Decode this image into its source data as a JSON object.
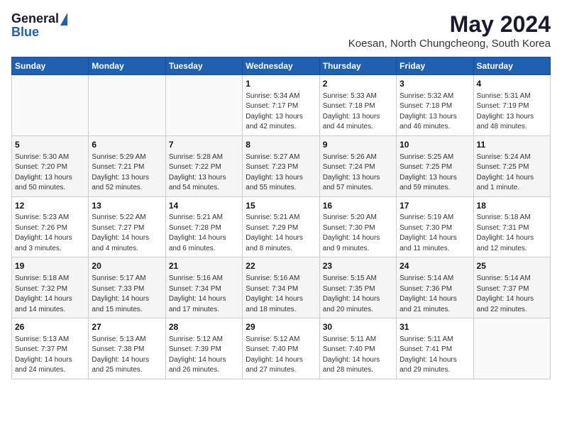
{
  "logo": {
    "general": "General",
    "blue": "Blue"
  },
  "title": {
    "month": "May 2024",
    "location": "Koesan, North Chungcheong, South Korea"
  },
  "weekdays": [
    "Sunday",
    "Monday",
    "Tuesday",
    "Wednesday",
    "Thursday",
    "Friday",
    "Saturday"
  ],
  "weeks": [
    [
      {
        "day": "",
        "sunrise": "",
        "sunset": "",
        "daylight": ""
      },
      {
        "day": "",
        "sunrise": "",
        "sunset": "",
        "daylight": ""
      },
      {
        "day": "",
        "sunrise": "",
        "sunset": "",
        "daylight": ""
      },
      {
        "day": "1",
        "sunrise": "Sunrise: 5:34 AM",
        "sunset": "Sunset: 7:17 PM",
        "daylight": "Daylight: 13 hours and 42 minutes."
      },
      {
        "day": "2",
        "sunrise": "Sunrise: 5:33 AM",
        "sunset": "Sunset: 7:18 PM",
        "daylight": "Daylight: 13 hours and 44 minutes."
      },
      {
        "day": "3",
        "sunrise": "Sunrise: 5:32 AM",
        "sunset": "Sunset: 7:18 PM",
        "daylight": "Daylight: 13 hours and 46 minutes."
      },
      {
        "day": "4",
        "sunrise": "Sunrise: 5:31 AM",
        "sunset": "Sunset: 7:19 PM",
        "daylight": "Daylight: 13 hours and 48 minutes."
      }
    ],
    [
      {
        "day": "5",
        "sunrise": "Sunrise: 5:30 AM",
        "sunset": "Sunset: 7:20 PM",
        "daylight": "Daylight: 13 hours and 50 minutes."
      },
      {
        "day": "6",
        "sunrise": "Sunrise: 5:29 AM",
        "sunset": "Sunset: 7:21 PM",
        "daylight": "Daylight: 13 hours and 52 minutes."
      },
      {
        "day": "7",
        "sunrise": "Sunrise: 5:28 AM",
        "sunset": "Sunset: 7:22 PM",
        "daylight": "Daylight: 13 hours and 54 minutes."
      },
      {
        "day": "8",
        "sunrise": "Sunrise: 5:27 AM",
        "sunset": "Sunset: 7:23 PM",
        "daylight": "Daylight: 13 hours and 55 minutes."
      },
      {
        "day": "9",
        "sunrise": "Sunrise: 5:26 AM",
        "sunset": "Sunset: 7:24 PM",
        "daylight": "Daylight: 13 hours and 57 minutes."
      },
      {
        "day": "10",
        "sunrise": "Sunrise: 5:25 AM",
        "sunset": "Sunset: 7:25 PM",
        "daylight": "Daylight: 13 hours and 59 minutes."
      },
      {
        "day": "11",
        "sunrise": "Sunrise: 5:24 AM",
        "sunset": "Sunset: 7:25 PM",
        "daylight": "Daylight: 14 hours and 1 minute."
      }
    ],
    [
      {
        "day": "12",
        "sunrise": "Sunrise: 5:23 AM",
        "sunset": "Sunset: 7:26 PM",
        "daylight": "Daylight: 14 hours and 3 minutes."
      },
      {
        "day": "13",
        "sunrise": "Sunrise: 5:22 AM",
        "sunset": "Sunset: 7:27 PM",
        "daylight": "Daylight: 14 hours and 4 minutes."
      },
      {
        "day": "14",
        "sunrise": "Sunrise: 5:21 AM",
        "sunset": "Sunset: 7:28 PM",
        "daylight": "Daylight: 14 hours and 6 minutes."
      },
      {
        "day": "15",
        "sunrise": "Sunrise: 5:21 AM",
        "sunset": "Sunset: 7:29 PM",
        "daylight": "Daylight: 14 hours and 8 minutes."
      },
      {
        "day": "16",
        "sunrise": "Sunrise: 5:20 AM",
        "sunset": "Sunset: 7:30 PM",
        "daylight": "Daylight: 14 hours and 9 minutes."
      },
      {
        "day": "17",
        "sunrise": "Sunrise: 5:19 AM",
        "sunset": "Sunset: 7:30 PM",
        "daylight": "Daylight: 14 hours and 11 minutes."
      },
      {
        "day": "18",
        "sunrise": "Sunrise: 5:18 AM",
        "sunset": "Sunset: 7:31 PM",
        "daylight": "Daylight: 14 hours and 12 minutes."
      }
    ],
    [
      {
        "day": "19",
        "sunrise": "Sunrise: 5:18 AM",
        "sunset": "Sunset: 7:32 PM",
        "daylight": "Daylight: 14 hours and 14 minutes."
      },
      {
        "day": "20",
        "sunrise": "Sunrise: 5:17 AM",
        "sunset": "Sunset: 7:33 PM",
        "daylight": "Daylight: 14 hours and 15 minutes."
      },
      {
        "day": "21",
        "sunrise": "Sunrise: 5:16 AM",
        "sunset": "Sunset: 7:34 PM",
        "daylight": "Daylight: 14 hours and 17 minutes."
      },
      {
        "day": "22",
        "sunrise": "Sunrise: 5:16 AM",
        "sunset": "Sunset: 7:34 PM",
        "daylight": "Daylight: 14 hours and 18 minutes."
      },
      {
        "day": "23",
        "sunrise": "Sunrise: 5:15 AM",
        "sunset": "Sunset: 7:35 PM",
        "daylight": "Daylight: 14 hours and 20 minutes."
      },
      {
        "day": "24",
        "sunrise": "Sunrise: 5:14 AM",
        "sunset": "Sunset: 7:36 PM",
        "daylight": "Daylight: 14 hours and 21 minutes."
      },
      {
        "day": "25",
        "sunrise": "Sunrise: 5:14 AM",
        "sunset": "Sunset: 7:37 PM",
        "daylight": "Daylight: 14 hours and 22 minutes."
      }
    ],
    [
      {
        "day": "26",
        "sunrise": "Sunrise: 5:13 AM",
        "sunset": "Sunset: 7:37 PM",
        "daylight": "Daylight: 14 hours and 24 minutes."
      },
      {
        "day": "27",
        "sunrise": "Sunrise: 5:13 AM",
        "sunset": "Sunset: 7:38 PM",
        "daylight": "Daylight: 14 hours and 25 minutes."
      },
      {
        "day": "28",
        "sunrise": "Sunrise: 5:12 AM",
        "sunset": "Sunset: 7:39 PM",
        "daylight": "Daylight: 14 hours and 26 minutes."
      },
      {
        "day": "29",
        "sunrise": "Sunrise: 5:12 AM",
        "sunset": "Sunset: 7:40 PM",
        "daylight": "Daylight: 14 hours and 27 minutes."
      },
      {
        "day": "30",
        "sunrise": "Sunrise: 5:11 AM",
        "sunset": "Sunset: 7:40 PM",
        "daylight": "Daylight: 14 hours and 28 minutes."
      },
      {
        "day": "31",
        "sunrise": "Sunrise: 5:11 AM",
        "sunset": "Sunset: 7:41 PM",
        "daylight": "Daylight: 14 hours and 29 minutes."
      },
      {
        "day": "",
        "sunrise": "",
        "sunset": "",
        "daylight": ""
      }
    ]
  ]
}
